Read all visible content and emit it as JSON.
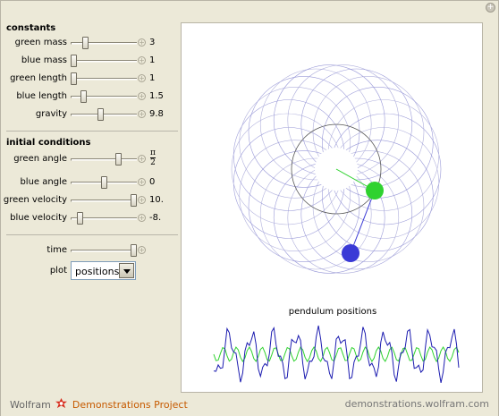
{
  "corner_button": "+",
  "sections": {
    "constants": "constants",
    "initial": "initial conditions"
  },
  "controls": {
    "green_mass": {
      "label": "green mass",
      "value": "3",
      "level": 0.2
    },
    "blue_mass": {
      "label": "blue mass",
      "value": "1",
      "level": 0.0
    },
    "green_length": {
      "label": "green length",
      "value": "1",
      "level": 0.0
    },
    "blue_length": {
      "label": "blue length",
      "value": "1.5",
      "level": 0.17
    },
    "gravity": {
      "label": "gravity",
      "value": "9.8",
      "level": 0.45
    },
    "green_angle": {
      "label": "green angle",
      "value_num": "π",
      "value_den": "2",
      "level": 0.75
    },
    "blue_angle": {
      "label": "blue angle",
      "value": "0",
      "level": 0.5
    },
    "green_velocity": {
      "label": "green velocity",
      "value": "10.",
      "level": 1.0
    },
    "blue_velocity": {
      "label": "blue velocity",
      "value": "-8.",
      "level": 0.1
    },
    "time": {
      "label": "time",
      "value": "",
      "level": 1.0
    }
  },
  "plot": {
    "label": "plot",
    "selected": "positions"
  },
  "plus_glyph": "+",
  "graph_title": "pendulum positions",
  "colors": {
    "green": "#2fd22f",
    "blue": "#3a3ad6",
    "trace": "#9a9ad8"
  },
  "footer": {
    "wolfram": "Wolfram",
    "project": "Demonstrations Project",
    "site": "demonstrations.wolfram.com"
  }
}
